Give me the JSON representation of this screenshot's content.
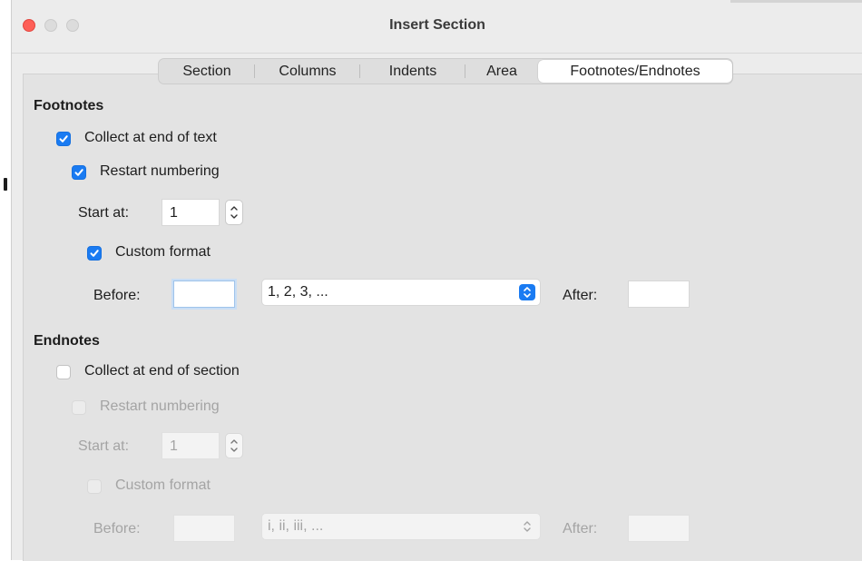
{
  "window": {
    "title": "Insert Section"
  },
  "tabs": [
    {
      "label": "Section",
      "selected": false
    },
    {
      "label": "Columns",
      "selected": false
    },
    {
      "label": "Indents",
      "selected": false
    },
    {
      "label": "Area",
      "selected": false
    },
    {
      "label": "Footnotes/Endnotes",
      "selected": true
    }
  ],
  "footnotes": {
    "heading": "Footnotes",
    "collect_label": "Collect at end of text",
    "collect_checked": true,
    "restart_label": "Restart numbering",
    "restart_checked": true,
    "start_at_label": "Start at:",
    "start_at_value": "1",
    "custom_label": "Custom format",
    "custom_checked": true,
    "before_label": "Before:",
    "before_value": "",
    "format_value": "1, 2, 3, ...",
    "after_label": "After:",
    "after_value": ""
  },
  "endnotes": {
    "heading": "Endnotes",
    "collect_label": "Collect at end of section",
    "collect_checked": false,
    "restart_label": "Restart numbering",
    "restart_checked": false,
    "start_at_label": "Start at:",
    "start_at_value": "1",
    "custom_label": "Custom format",
    "custom_checked": false,
    "before_label": "Before:",
    "before_value": "",
    "format_value": "i, ii, iii, ...",
    "after_label": "After:",
    "after_value": ""
  },
  "colors": {
    "accent": "#1a7bf2",
    "close_button": "#fe5f57",
    "dialog_background": "#ececec",
    "disabled_text": "#a4a4a4"
  },
  "icons": {
    "check": "checkmark-icon",
    "stepper": "stepper-arrows-icon",
    "select": "chevron-up-down-icon"
  }
}
